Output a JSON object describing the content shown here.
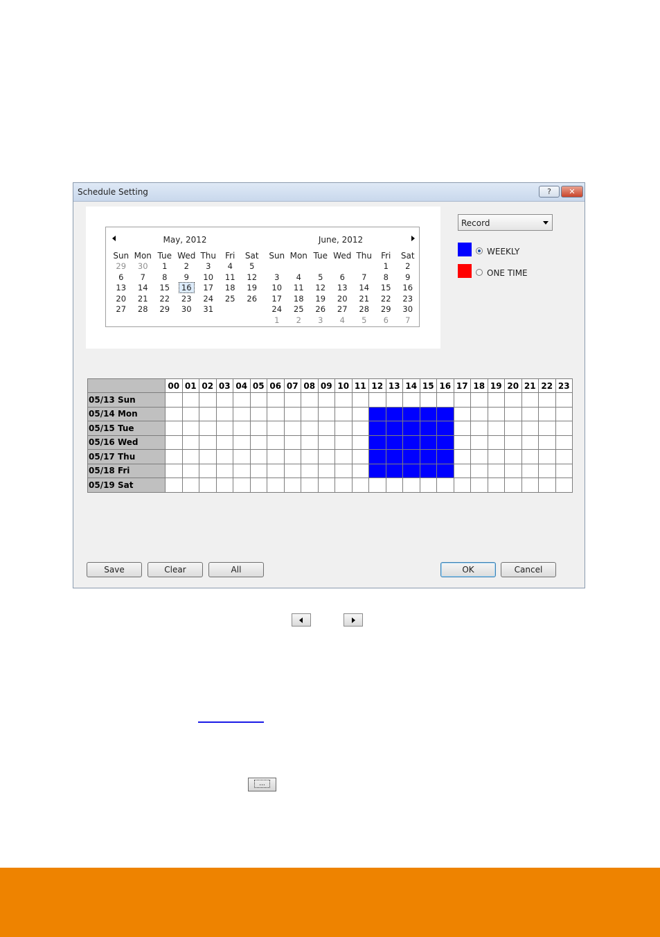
{
  "window": {
    "title": "Schedule Setting",
    "help_label": "?",
    "close_label": "✕"
  },
  "calendar": {
    "months": [
      {
        "title": "May, 2012",
        "weekdays": [
          "Sun",
          "Mon",
          "Tue",
          "Wed",
          "Thu",
          "Fri",
          "Sat"
        ],
        "weeks": [
          [
            {
              "d": "29",
              "dim": true
            },
            {
              "d": "30",
              "dim": true
            },
            {
              "d": "1"
            },
            {
              "d": "2"
            },
            {
              "d": "3"
            },
            {
              "d": "4"
            },
            {
              "d": "5"
            }
          ],
          [
            {
              "d": "6"
            },
            {
              "d": "7"
            },
            {
              "d": "8"
            },
            {
              "d": "9"
            },
            {
              "d": "10"
            },
            {
              "d": "11"
            },
            {
              "d": "12"
            }
          ],
          [
            {
              "d": "13"
            },
            {
              "d": "14"
            },
            {
              "d": "15"
            },
            {
              "d": "16",
              "today": true
            },
            {
              "d": "17"
            },
            {
              "d": "18"
            },
            {
              "d": "19"
            }
          ],
          [
            {
              "d": "20"
            },
            {
              "d": "21"
            },
            {
              "d": "22"
            },
            {
              "d": "23"
            },
            {
              "d": "24"
            },
            {
              "d": "25"
            },
            {
              "d": "26"
            }
          ],
          [
            {
              "d": "27"
            },
            {
              "d": "28"
            },
            {
              "d": "29"
            },
            {
              "d": "30"
            },
            {
              "d": "31"
            },
            {
              "d": ""
            },
            {
              "d": ""
            }
          ],
          [
            {
              "d": ""
            },
            {
              "d": ""
            },
            {
              "d": ""
            },
            {
              "d": ""
            },
            {
              "d": ""
            },
            {
              "d": ""
            },
            {
              "d": ""
            }
          ]
        ]
      },
      {
        "title": "June, 2012",
        "weekdays": [
          "Sun",
          "Mon",
          "Tue",
          "Wed",
          "Thu",
          "Fri",
          "Sat"
        ],
        "weeks": [
          [
            {
              "d": ""
            },
            {
              "d": ""
            },
            {
              "d": ""
            },
            {
              "d": ""
            },
            {
              "d": ""
            },
            {
              "d": "1"
            },
            {
              "d": "2"
            }
          ],
          [
            {
              "d": "3"
            },
            {
              "d": "4"
            },
            {
              "d": "5"
            },
            {
              "d": "6"
            },
            {
              "d": "7"
            },
            {
              "d": "8"
            },
            {
              "d": "9"
            }
          ],
          [
            {
              "d": "10"
            },
            {
              "d": "11"
            },
            {
              "d": "12"
            },
            {
              "d": "13"
            },
            {
              "d": "14"
            },
            {
              "d": "15"
            },
            {
              "d": "16"
            }
          ],
          [
            {
              "d": "17"
            },
            {
              "d": "18"
            },
            {
              "d": "19"
            },
            {
              "d": "20"
            },
            {
              "d": "21"
            },
            {
              "d": "22"
            },
            {
              "d": "23"
            }
          ],
          [
            {
              "d": "24"
            },
            {
              "d": "25"
            },
            {
              "d": "26"
            },
            {
              "d": "27"
            },
            {
              "d": "28"
            },
            {
              "d": "29"
            },
            {
              "d": "30"
            }
          ],
          [
            {
              "d": "1",
              "dim": true
            },
            {
              "d": "2",
              "dim": true
            },
            {
              "d": "3",
              "dim": true
            },
            {
              "d": "4",
              "dim": true
            },
            {
              "d": "5",
              "dim": true
            },
            {
              "d": "6",
              "dim": true
            },
            {
              "d": "7",
              "dim": true
            }
          ]
        ]
      }
    ]
  },
  "mode_select": {
    "value": "Record"
  },
  "schedule_types": {
    "weekly": {
      "label": "WEEKLY",
      "color": "#0000ff",
      "selected": true
    },
    "one_time": {
      "label": "ONE TIME",
      "color": "#ff0000",
      "selected": false
    }
  },
  "grid": {
    "hours": [
      "00",
      "01",
      "02",
      "03",
      "04",
      "05",
      "06",
      "07",
      "08",
      "09",
      "10",
      "11",
      "12",
      "13",
      "14",
      "15",
      "16",
      "17",
      "18",
      "19",
      "20",
      "21",
      "22",
      "23"
    ],
    "rows": [
      {
        "label": "05/13 Sun",
        "on": []
      },
      {
        "label": "05/14 Mon",
        "on": [
          12,
          13,
          14,
          15,
          16
        ]
      },
      {
        "label": "05/15 Tue",
        "on": [
          12,
          13,
          14,
          15,
          16
        ]
      },
      {
        "label": "05/16 Wed",
        "on": [
          12,
          13,
          14,
          15,
          16
        ]
      },
      {
        "label": "05/17 Thu",
        "on": [
          12,
          13,
          14,
          15,
          16
        ]
      },
      {
        "label": "05/18 Fri",
        "on": [
          12,
          13,
          14,
          15,
          16
        ]
      },
      {
        "label": "05/19 Sat",
        "on": []
      }
    ],
    "on_color": "#0000ff"
  },
  "buttons": {
    "save": "Save",
    "clear": "Clear",
    "all": "All",
    "ok": "OK",
    "cancel": "Cancel"
  },
  "browse_button": {
    "label": "..."
  },
  "footer_color": "#ee8300"
}
